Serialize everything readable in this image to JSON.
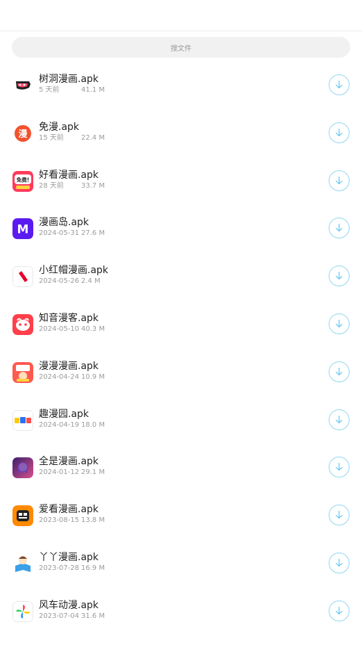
{
  "search": {
    "placeholder": "搜文件"
  },
  "files": [
    {
      "name": "树洞漫画.apk",
      "date": "5 天前",
      "size": "41.1 M",
      "icon": "treehole-icon"
    },
    {
      "name": "免漫.apk",
      "date": "15 天前",
      "size": "22.4 M",
      "icon": "manga-char-icon",
      "icon_text": "漫"
    },
    {
      "name": "好看漫画.apk",
      "date": "28 天前",
      "size": "33.7 M",
      "icon": "free-badge-icon",
      "icon_text": "免费!"
    },
    {
      "name": "漫画岛.apk",
      "date": "2024-05-31",
      "size": "27.6 M",
      "icon": "m-letter-icon",
      "icon_text": "M"
    },
    {
      "name": "小红帽漫画.apk",
      "date": "2024-05-26",
      "size": "2.4 M",
      "icon": "red-hat-icon"
    },
    {
      "name": "知音漫客.apk",
      "date": "2024-05-10",
      "size": "40.3 M",
      "icon": "smile-face-icon"
    },
    {
      "name": "漫漫漫画.apk",
      "date": "2024-04-24",
      "size": "10.9 M",
      "icon": "manman-icon"
    },
    {
      "name": "趣漫园.apk",
      "date": "2024-04-19",
      "size": "18.0 M",
      "icon": "qumanyuan-icon"
    },
    {
      "name": "全是漫画.apk",
      "date": "2024-01-12",
      "size": "29.1 M",
      "icon": "anime-girl-icon"
    },
    {
      "name": "爱看漫画.apk",
      "date": "2023-08-15",
      "size": "13.8 M",
      "icon": "aikan-icon"
    },
    {
      "name": "丫丫漫画.apk",
      "date": "2023-07-28",
      "size": "16.9 M",
      "icon": "yaya-icon"
    },
    {
      "name": "风车动漫.apk",
      "date": "2023-07-04",
      "size": "31.6 M",
      "icon": "pinwheel-icon"
    }
  ],
  "colors": {
    "download_ring": "#8fd6f2",
    "download_arrow": "#5cc4ee"
  }
}
